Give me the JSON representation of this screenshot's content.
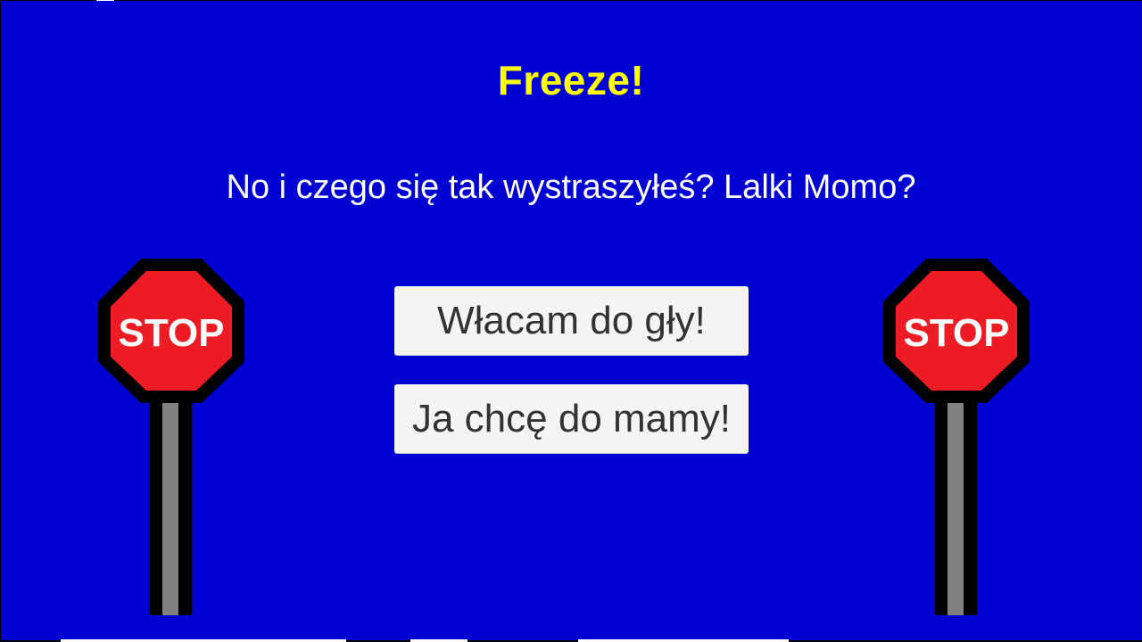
{
  "screen": {
    "title": "Freeze!",
    "message": "No i czego się tak wystraszyłeś? Lalki Momo?",
    "buttons": [
      {
        "label": "Włacam do gły!"
      },
      {
        "label": "Ja chcę do mamy!"
      }
    ],
    "signs": [
      {
        "icon": "stop-sign-icon",
        "text": "STOP"
      },
      {
        "icon": "stop-sign-icon",
        "text": "STOP"
      }
    ]
  },
  "colors": {
    "background": "#0000d3",
    "title": "#ffff00",
    "message": "#ffffff",
    "button_bg": "#f4f4f4",
    "button_text": "#323232",
    "sign_red": "#ed1c24",
    "pole_gray": "#808080"
  }
}
